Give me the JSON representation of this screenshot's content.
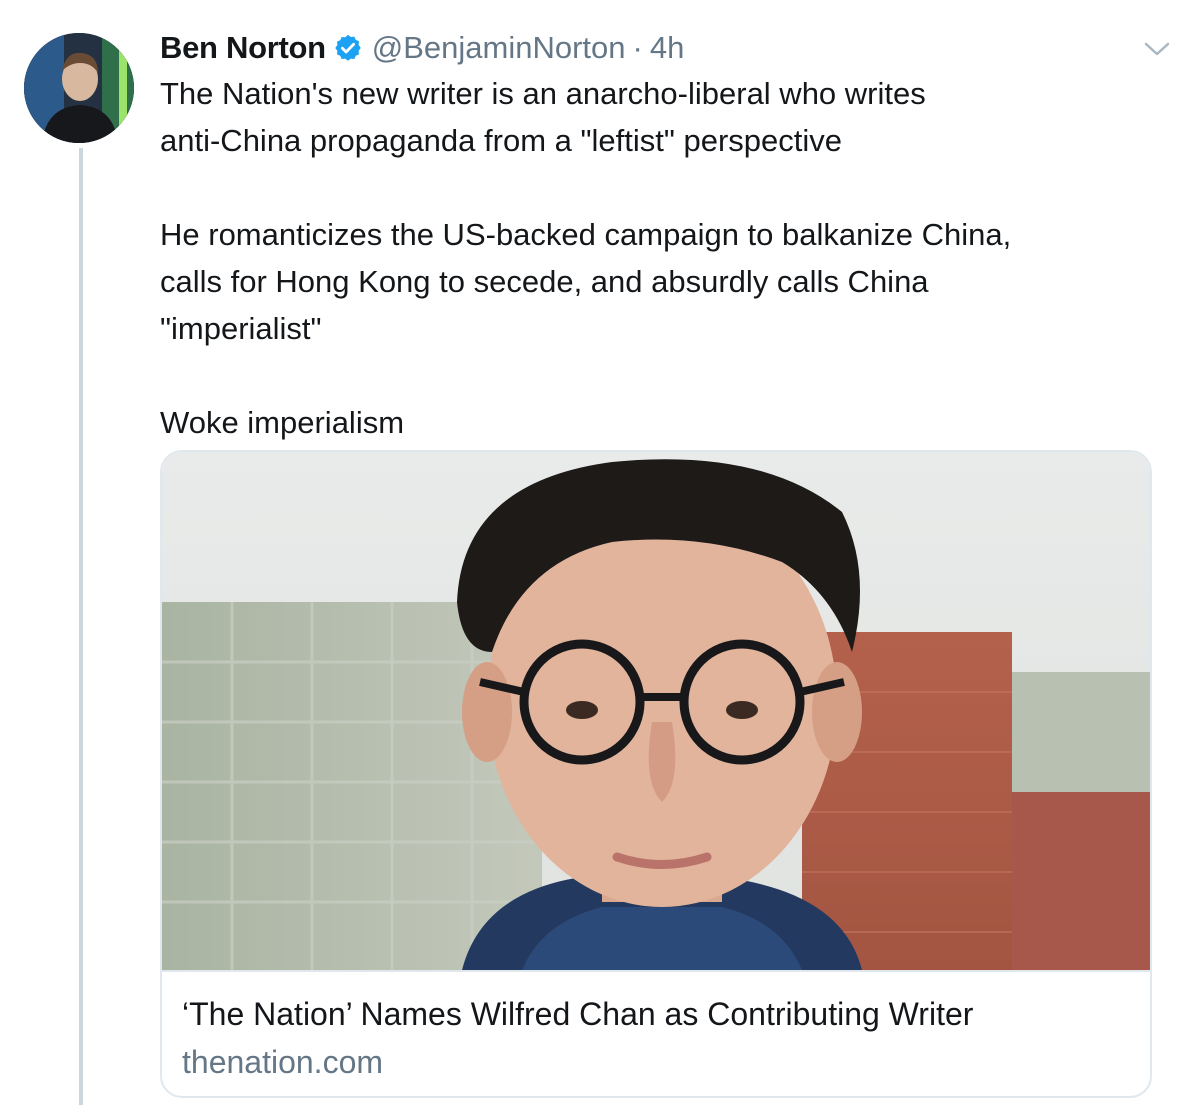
{
  "tweet": {
    "author_name": "Ben Norton",
    "handle": "@BenjaminNorton",
    "separator": "·",
    "time": "4h",
    "lines": [
      "The Nation's new writer is an anarcho-liberal who writes",
      "anti-China propaganda from a \"leftist\" perspective",
      "He romanticizes the US-backed campaign to balkanize China,",
      "calls for Hong Kong to secede, and absurdly calls China",
      "\"imperialist\"",
      "Woke imperialism"
    ]
  },
  "card": {
    "title": "‘The Nation’ Names Wilfred Chan as Contributing Writer",
    "domain": "thenation.com"
  },
  "icons": {
    "verified": "verified-badge-icon",
    "menu": "chevron-down-icon"
  },
  "colors": {
    "verified_blue": "#1da1f2",
    "secondary_text": "#657786",
    "border": "#e1e8ed"
  }
}
